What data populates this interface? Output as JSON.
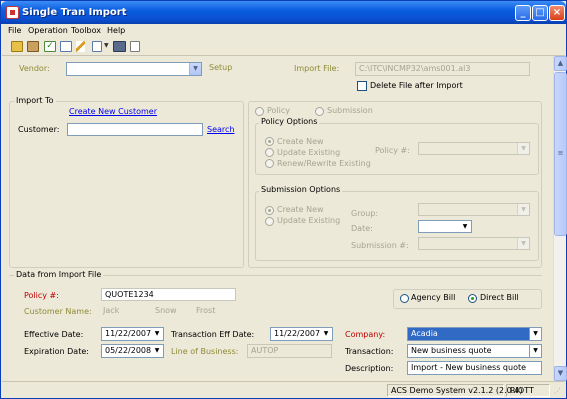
{
  "window": {
    "title": "Single Tran Import"
  },
  "menu": [
    "File",
    "Operation",
    "Toolbox",
    "Help"
  ],
  "toolbar_icons": [
    "open-folder-icon",
    "clipboard-icon",
    "check-icon",
    "import-icon",
    "pencil-icon",
    "document-icon",
    "binoculars-icon",
    "page-icon"
  ],
  "top": {
    "vendor_label": "Vendor:",
    "vendor_value": "",
    "setup_label": "Setup",
    "import_file_label": "Import File:",
    "import_file_value": "C:\\ITC\\INCMP32\\ams001.al3",
    "delete_file_label": "Delete File after Import"
  },
  "import_to": {
    "title": "Import To",
    "create_customer_link": "Create New Customer",
    "customer_label": "Customer:",
    "customer_value": "",
    "search_link": "Search"
  },
  "mode": {
    "policy_label": "Policy",
    "submission_label": "Submission"
  },
  "policy_options": {
    "title": "Policy Options",
    "create_new": "Create New",
    "update_existing": "Update Existing",
    "renew_rewrite": "Renew/Rewrite Existing",
    "policy_num_label": "Policy #:",
    "policy_num_value": ""
  },
  "submission_options": {
    "title": "Submission Options",
    "create_new": "Create New",
    "update_existing": "Update Existing",
    "group_label": "Group:",
    "date_label": "Date:",
    "submission_num_label": "Submission #:"
  },
  "data_from_file": {
    "title": "Data from Import File",
    "policy_label": "Policy #:",
    "policy_value": "QUOTE1234",
    "customer_name_label": "Customer Name:",
    "first_name": "Jack",
    "last_name": "Snow",
    "city": "Frost",
    "agency_bill": "Agency Bill",
    "direct_bill": "Direct Bill",
    "effective_date_label": "Effective Date:",
    "effective_date_value": "11/22/2007",
    "transaction_eff_label": "Transaction Eff Date:",
    "transaction_eff_value": "11/22/2007",
    "company_label": "Company:",
    "company_value": "Acadia",
    "expiration_date_label": "Expiration Date:",
    "expiration_date_value": "05/22/2008",
    "line_of_business_label": "Line of Business:",
    "line_of_business_value": "AUTOP",
    "transaction_label": "Transaction:",
    "transaction_value": "New business quote",
    "description_label": "Description:",
    "description_value": "Import - New business quote"
  },
  "status": {
    "system": "ACS Demo System v2.1.2 (2.0.4)",
    "user": "RIOTT"
  }
}
